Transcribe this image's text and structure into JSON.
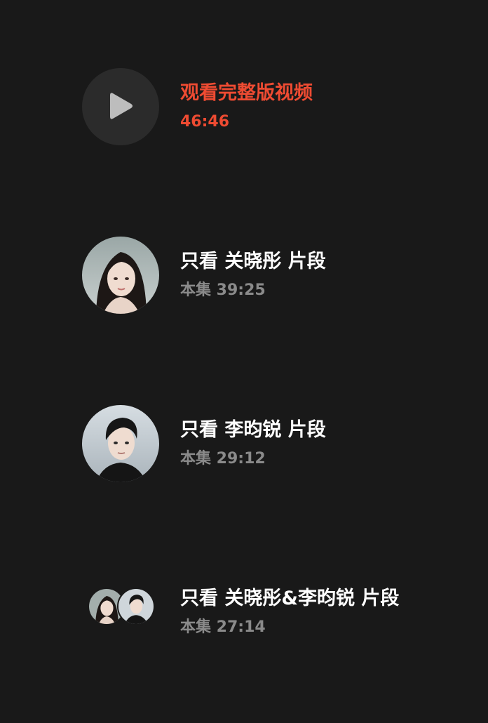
{
  "full_video": {
    "title": "观看完整版视频",
    "duration": "46:46",
    "icon": "play-icon",
    "accent_color": "#ee4b32"
  },
  "segments": [
    {
      "title": "只看 关晓彤 片段",
      "duration_label": "本集 39:25",
      "avatar": "avatar-guan-xiaotong"
    },
    {
      "title": "只看 李昀锐 片段",
      "duration_label": "本集 29:12",
      "avatar": "avatar-li-yunrui"
    },
    {
      "title": "只看 关晓彤&李昀锐 片段",
      "duration_label": "本集 27:14",
      "avatar": "avatar-pair"
    }
  ]
}
